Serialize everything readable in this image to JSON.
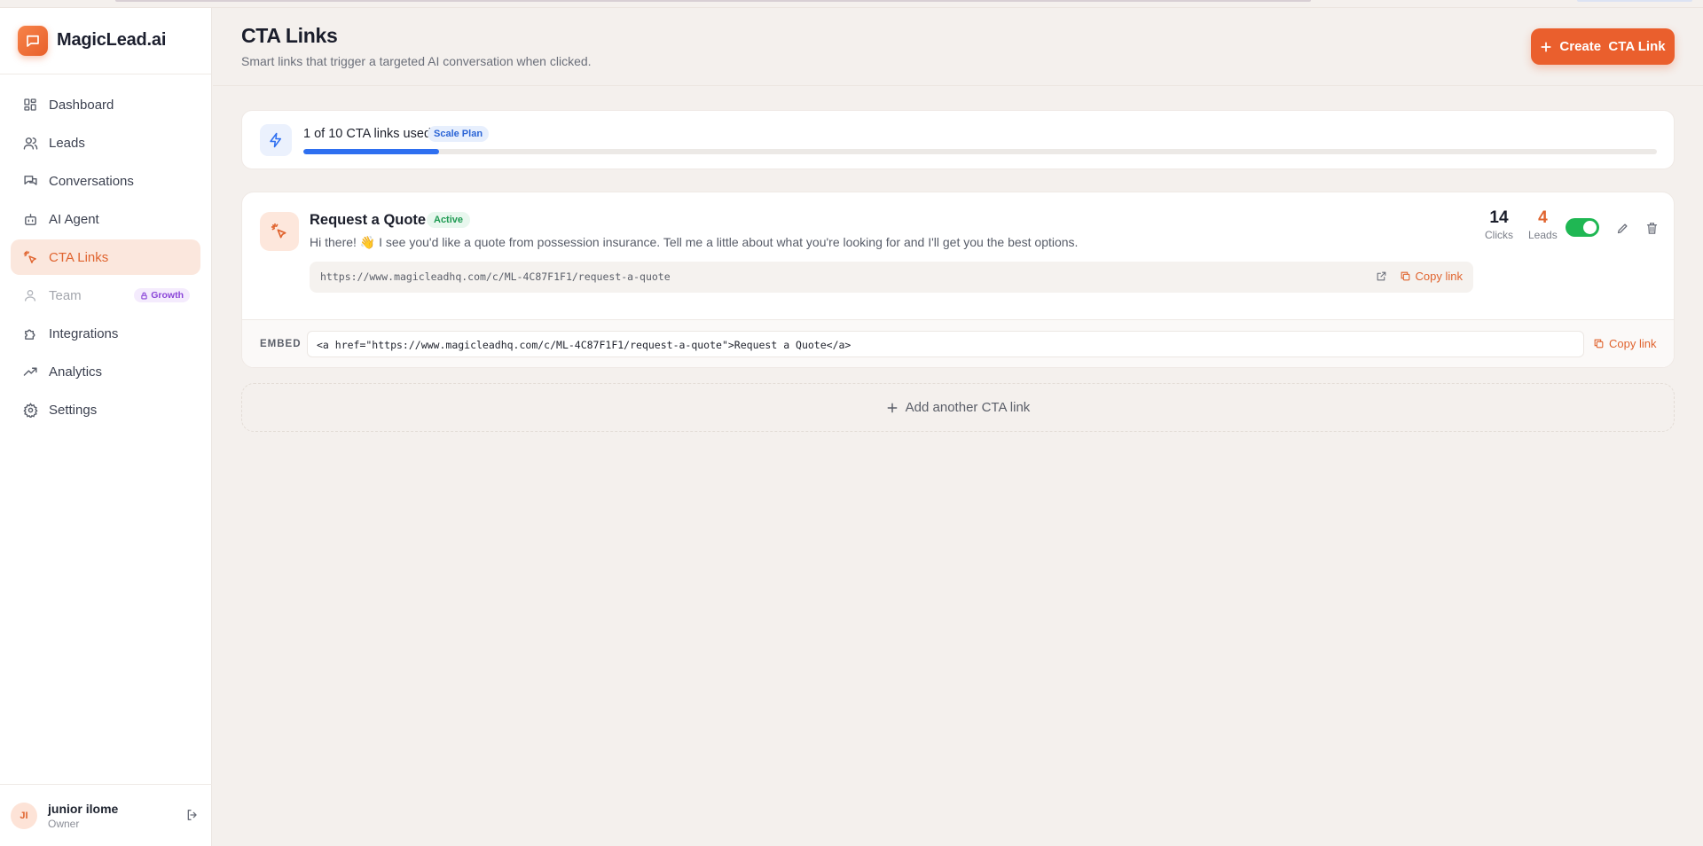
{
  "brand": {
    "name": "MagicLead.ai"
  },
  "sidebar": {
    "items": [
      {
        "label": "Dashboard",
        "icon": "grid-icon"
      },
      {
        "label": "Leads",
        "icon": "users-icon"
      },
      {
        "label": "Conversations",
        "icon": "chat-bubbles-icon"
      },
      {
        "label": "AI Agent",
        "icon": "robot-icon"
      },
      {
        "label": "CTA Links",
        "icon": "pointer-click-icon",
        "active": true
      },
      {
        "label": "Team",
        "icon": "user-icon",
        "disabled": true,
        "badge": "Growth"
      },
      {
        "label": "Integrations",
        "icon": "puzzle-icon"
      },
      {
        "label": "Analytics",
        "icon": "trend-up-icon"
      },
      {
        "label": "Settings",
        "icon": "gear-icon"
      }
    ]
  },
  "user": {
    "initials": "JI",
    "name": "junior ilome",
    "role": "Owner"
  },
  "header": {
    "title": "CTA Links",
    "subtitle": "Smart links that trigger a targeted AI conversation when clicked.",
    "create_label": "Create  CTA Link"
  },
  "usage": {
    "text": "1 of 10 CTA links used",
    "plan": "Scale Plan",
    "used": 1,
    "limit": 10
  },
  "cta": {
    "name": "Request a Quote",
    "status": "Active",
    "message": "Hi there! 👋 I see you'd like a quote from possession insurance. Tell me a little about what you're looking for and I'll get you the best options.",
    "url": "https://www.magicleadhq.com/c/ML-4C87F1F1/request-a-quote",
    "copy_label": "Copy link",
    "clicks": "14",
    "clicks_label": "Clicks",
    "leads": "4",
    "leads_label": "Leads",
    "enabled": true,
    "embed_label": "EMBED",
    "embed_code": "<a href=\"https://www.magicleadhq.com/c/ML-4C87F1F1/request-a-quote\">Request a Quote</a>",
    "embed_copy_label": "Copy link"
  },
  "add_label": "Add another CTA link",
  "colors": {
    "accent": "#ea5f2d",
    "progress": "#2e6ff0",
    "active_green": "#1fb753"
  }
}
